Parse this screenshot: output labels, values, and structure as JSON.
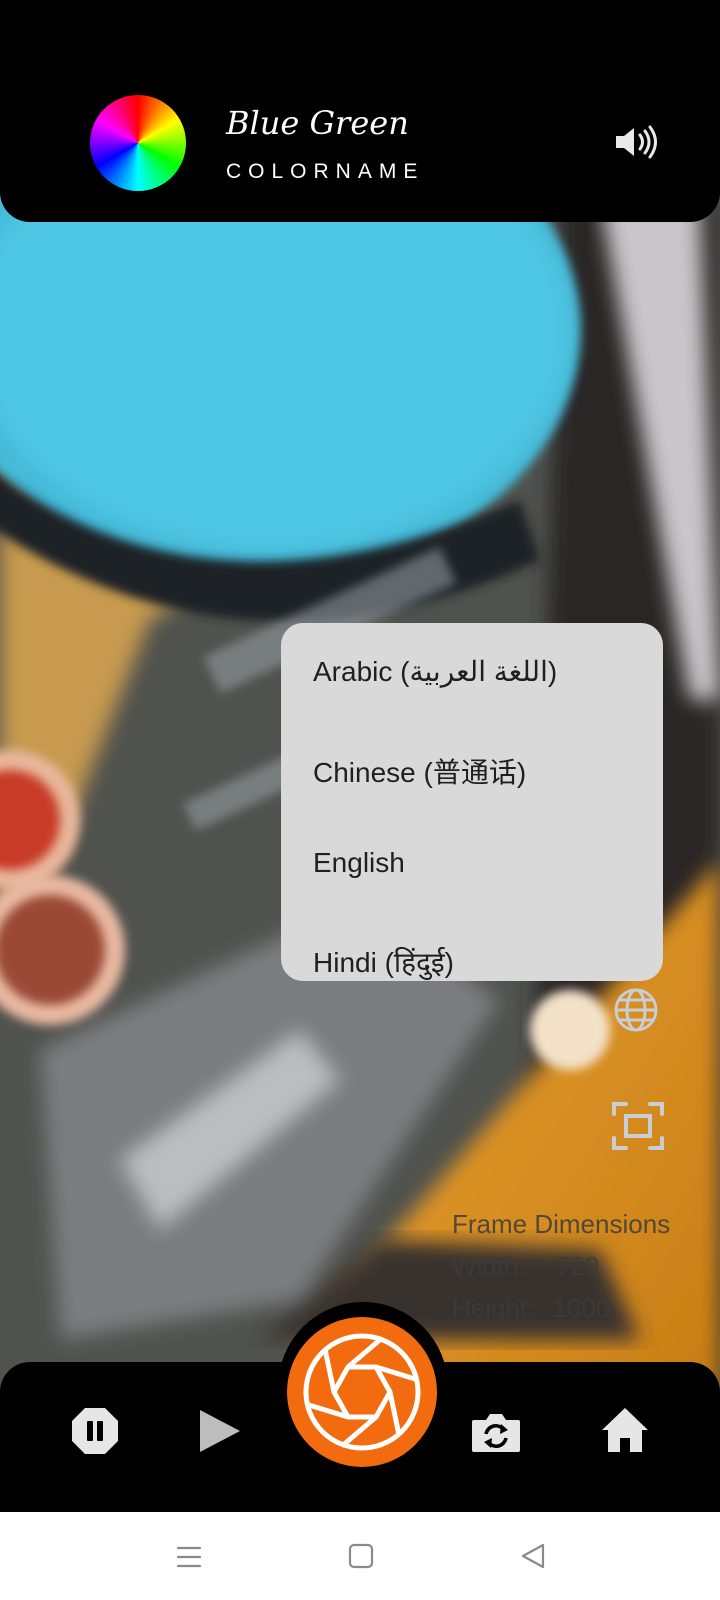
{
  "header": {
    "color_name": "Blue Green",
    "color_label": "COLORNAME"
  },
  "language_menu": {
    "items": [
      {
        "label": "Arabic (اللغة العربية)"
      },
      {
        "label": "Chinese (普通话)"
      },
      {
        "label": "English"
      },
      {
        "label": "Hindi (हिंदुई)"
      }
    ]
  },
  "frame_info": {
    "title": "Frame Dimensions",
    "width_label": "Width:",
    "width_value": "720",
    "height_label": "Height:",
    "height_value": "1600"
  },
  "bottom_bar": {
    "icons": [
      "pause-icon",
      "play-icon",
      "shutter-icon",
      "switch-camera-icon",
      "home-icon"
    ],
    "accent_color": "#f26b0e"
  },
  "nav_bar": {
    "icons": [
      "menu-icon",
      "home-square-icon",
      "back-icon"
    ]
  }
}
